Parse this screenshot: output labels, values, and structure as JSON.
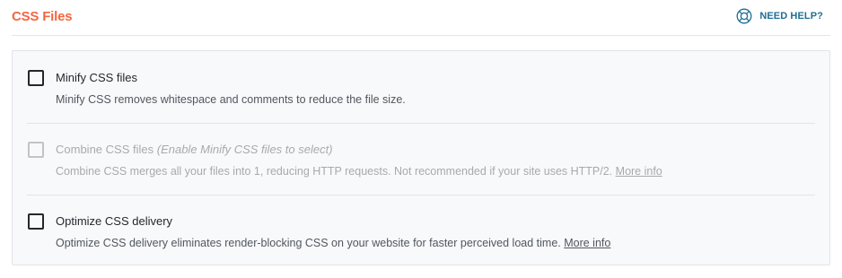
{
  "section": {
    "title": "CSS Files",
    "help_label": "NEED HELP?",
    "help_icon": "lifebuoy-icon"
  },
  "colors": {
    "title": "#f56640",
    "help": "#1f6e93",
    "panel_bg": "#f8f9fb"
  },
  "options": [
    {
      "label": "Minify CSS files",
      "hint": "",
      "description": "Minify CSS removes whitespace and comments to reduce the file size.",
      "more_info": "",
      "checked": false,
      "disabled": false
    },
    {
      "label": "Combine CSS files",
      "hint": "(Enable Minify CSS files to select)",
      "description": "Combine CSS merges all your files into 1, reducing HTTP requests. Not recommended if your site uses HTTP/2.",
      "more_info": "More info",
      "checked": false,
      "disabled": true
    },
    {
      "label": "Optimize CSS delivery",
      "hint": "",
      "description": "Optimize CSS delivery eliminates render-blocking CSS on your website for faster perceived load time.",
      "more_info": "More info",
      "checked": false,
      "disabled": false
    }
  ]
}
